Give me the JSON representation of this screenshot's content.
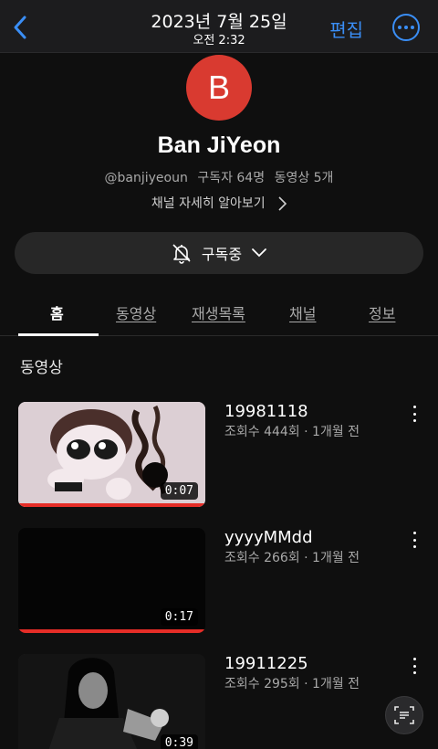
{
  "topbar": {
    "date": "2023년 7월 25일",
    "time": "오전 2:32",
    "edit_label": "편집"
  },
  "channel": {
    "avatar_letter": "B",
    "name": "Ban JiYeon",
    "handle": "@banjiyeoun",
    "subscribers": "구독자 64명",
    "videos_count": "동영상 5개",
    "more_info": "채널 자세히 알아보기"
  },
  "subscribe": {
    "label": "구독중"
  },
  "tabs": [
    {
      "label": "홈",
      "active": true
    },
    {
      "label": "동영상"
    },
    {
      "label": "재생목록"
    },
    {
      "label": "채널"
    },
    {
      "label": "정보"
    }
  ],
  "section": {
    "title": "동영상"
  },
  "videos": [
    {
      "title": "19981118",
      "meta": "조회수 444회 · 1개월 전",
      "duration": "0:07",
      "watched": 1.0
    },
    {
      "title": "yyyyMMdd",
      "meta": "조회수 266회 · 1개월 전",
      "duration": "0:17",
      "watched": 1.0
    },
    {
      "title": "19911225",
      "meta": "조회수 295회 · 1개월 전",
      "duration": "0:39",
      "watched": 0.0
    }
  ],
  "colors": {
    "accent_blue": "#3a8ef6",
    "avatar_red": "#d93a30",
    "progress_red": "#e52d27"
  },
  "icons": [
    "back-chevron-icon",
    "more-circle-icon",
    "bell-off-icon",
    "chevron-down-icon",
    "kebab-menu-icon",
    "text-scan-icon"
  ]
}
